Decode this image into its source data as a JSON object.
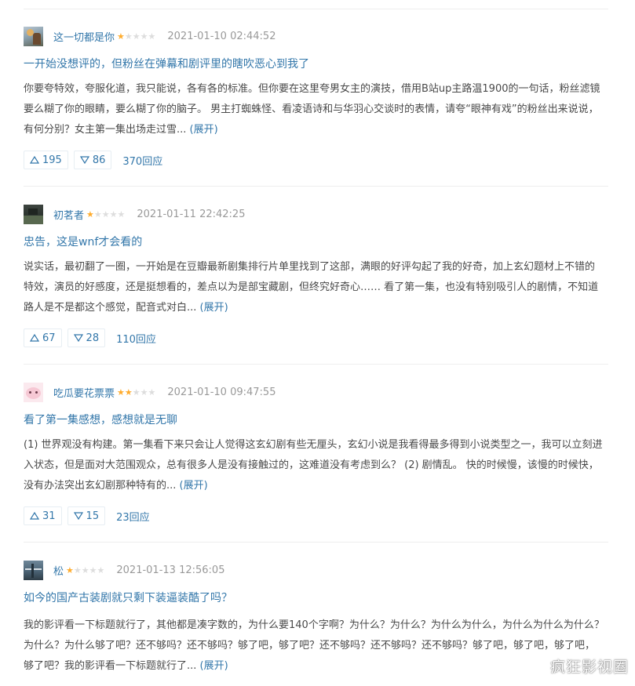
{
  "reviews": [
    {
      "author": "这一切都是你",
      "rating": 1,
      "max_rating": 5,
      "time": "2021-01-10 02:44:52",
      "title": "一开始没想评的，但粉丝在弹幕和剧评里的瞎吹恶心到我了",
      "body": "你要夸特效，夸服化道，我只能说，各有各的标准。但你要在这里夸男女主的演技，借用B站up主路温1900的一句话，粉丝滤镜要么糊了你的眼睛，要么糊了你的脑子。 男主打蜘蛛怪、看凌语诗和与华羽心交谈时的表情，请夸“眼神有戏”的粉丝出来说说，有何分别？女主第一集出场走过雪...",
      "expand": "(展开)",
      "up": "195",
      "down": "86",
      "replies": "370回应"
    },
    {
      "author": "初茗者",
      "rating": 1,
      "max_rating": 5,
      "time": "2021-01-11 22:42:25",
      "title": "忠告，这是wnf才会看的",
      "body": "说实话，最初翻了一圈，一开始是在豆瓣最新剧集排行片单里找到了这部，满眼的好评勾起了我的好奇，加上玄幻题材上不错的特效，演员的好感度，还是挺想看的，差点以为是部宝藏剧，但终究好奇心…… 看了第一集，也没有特别吸引人的剧情，不知道路人是不是都这个感觉，配音式对白...",
      "expand": "(展开)",
      "up": "67",
      "down": "28",
      "replies": "110回应"
    },
    {
      "author": "吃瓜要花票票",
      "rating": 2,
      "max_rating": 5,
      "time": "2021-01-10 09:47:55",
      "title": "看了第一集感想，感想就是无聊",
      "body": "(1) 世界观没有构建。第一集看下来只会让人觉得这玄幻剧有些无厘头，玄幻小说是我看得最多得到小说类型之一，我可以立刻进入状态，但是面对大范围观众，总有很多人是没有接触过的，这难道没有考虑到么？ (2) 剧情乱。 快的时候慢，该慢的时候快，没有办法突出玄幻剧那种特有的...",
      "expand": "(展开)",
      "up": "31",
      "down": "15",
      "replies": "23回应"
    },
    {
      "author": "松",
      "rating": 1,
      "max_rating": 5,
      "time": "2021-01-13 12:56:05",
      "title": "如今的国产古装剧就只剩下装逼装酷了吗？",
      "body": "我的影评看一下标题就行了，其他都是凑字数的，为什么要140个字啊？为什么？为什么？为什么为什么，为什么为什么为什么？为什么？为什么够了吧？还不够吗？还不够吗？够了吧，够了吧？还不够吗？还不够吗？还不够吗？够了吧，够了吧，够了吧，够了吧？我的影评看一下标题就行了...",
      "expand": "(展开)"
    }
  ],
  "watermark": "疯狂影视圈",
  "colors": {
    "link": "#3377aa",
    "star_on": "#ffac2d",
    "star_off": "#dddddd",
    "time": "#999999",
    "body": "#494949",
    "divider": "#eeeeee"
  },
  "icons": {
    "upvote": "triangle-up-outline-icon",
    "downvote": "triangle-down-outline-icon",
    "star": "star-icon"
  }
}
